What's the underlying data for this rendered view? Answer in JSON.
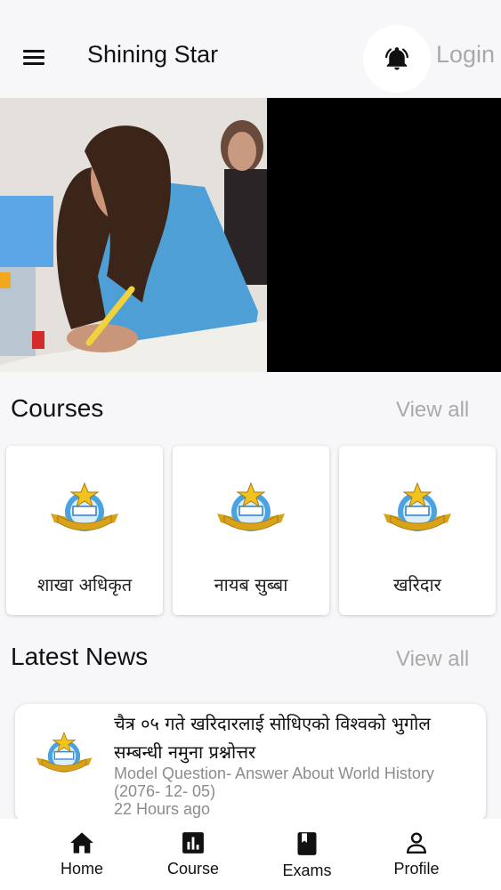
{
  "app": {
    "title": "Shining Star",
    "login_label": "Login"
  },
  "icons": {
    "menu": "menu-icon",
    "bell": "bell-icon"
  },
  "colors": {
    "background": "#f7f7f9",
    "muted": "#a9a9a9",
    "accent_gold": "#d9a21b",
    "accent_blue": "#2f7fc9"
  },
  "courses": {
    "title": "Courses",
    "view_all": "View all",
    "items": [
      {
        "label": "शाखा अधिकृत"
      },
      {
        "label": "नायब सुब्बा"
      },
      {
        "label": "खरिदार"
      }
    ]
  },
  "news": {
    "title": "Latest News",
    "view_all": "View all",
    "items": [
      {
        "title": "चैत्र ०५ गते खरिदारलाई सोधिएको विश्वको भुगोल सम्बन्धी नमुना प्रश्नोत्तर",
        "subtitle": "Model Question- Answer About World History (2076- 12- 05)",
        "time": "22 Hours ago"
      }
    ]
  },
  "bottom_nav": [
    {
      "label": "Home",
      "icon": "home-icon"
    },
    {
      "label": "Course",
      "icon": "bar-chart-icon"
    },
    {
      "label": "Exams",
      "icon": "book-icon"
    },
    {
      "label": "Profile",
      "icon": "person-icon"
    }
  ]
}
